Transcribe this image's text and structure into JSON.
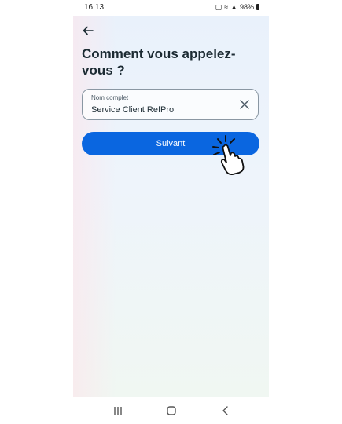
{
  "status_bar": {
    "time": "16:13",
    "battery_percent": "98%",
    "icons": [
      "lock-icon",
      "wifi-icon",
      "signal-icon",
      "battery-icon"
    ]
  },
  "header": {
    "back_icon": "back-arrow-icon"
  },
  "page": {
    "title": "Comment vous appelez-vous ?"
  },
  "name_field": {
    "label": "Nom complet",
    "value": "Service Client RefPro",
    "clear_icon": "close-icon"
  },
  "primary_action": {
    "label": "Suivant"
  },
  "overlay": {
    "icon": "tap-hand-icon"
  },
  "navigation_bar": {
    "items": [
      "recents-icon",
      "home-icon",
      "back-icon"
    ]
  },
  "colors": {
    "accent": "#0a66e0",
    "title_text": "#1c2b33",
    "field_border": "#8a97a3"
  }
}
